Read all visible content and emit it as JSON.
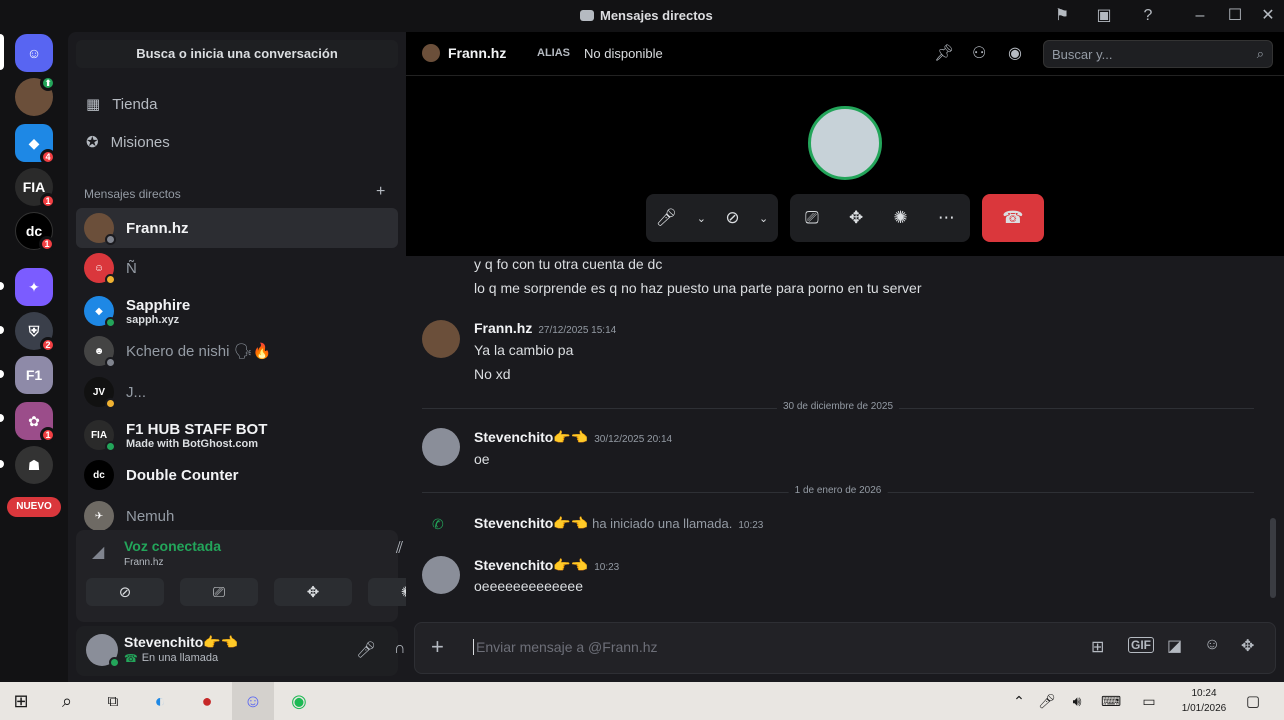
{
  "window": {
    "title": "Mensajes directos"
  },
  "rail": {
    "new_label": "NUEVO",
    "badges": [
      "4",
      "1",
      "1",
      "2",
      "1"
    ]
  },
  "sidebar": {
    "search_placeholder": "Busca o inicia una conversación",
    "nav": [
      {
        "label": "Tienda",
        "icon": "store-icon"
      },
      {
        "label": "Misiones",
        "icon": "quests-icon"
      }
    ],
    "dm_header": "Mensajes directos",
    "dms": [
      {
        "name": "Frann.hz",
        "sub": ""
      },
      {
        "name": "Ñ",
        "sub": ""
      },
      {
        "name": "Sapphire",
        "sub": "sapph.xyz"
      },
      {
        "name": "Kchero de nishi 🗣🔥",
        "sub": ""
      },
      {
        "name": "J...",
        "sub": ""
      },
      {
        "name": "F1 HUB STAFF BOT",
        "sub": "Made with BotGhost.com"
      },
      {
        "name": "Double Counter",
        "sub": ""
      },
      {
        "name": "Nemuh",
        "sub": ""
      }
    ]
  },
  "voice": {
    "status": "Voz conectada",
    "channel": "Frann.hz"
  },
  "user": {
    "name": "Stevenchito👉👈",
    "status": "En una llamada"
  },
  "header": {
    "name": "Frann.hz",
    "alias_label": "ALIAS",
    "alias_value": "No disponible",
    "search_placeholder": "Buscar y..."
  },
  "messages": {
    "line1": "y q fo con tu otra cuenta de dc",
    "line2": "lo q me sorprende es q no haz puesto una parte para porno en tu server",
    "m1_author": "Frann.hz",
    "m1_ts": "27/12/2025 15:14",
    "m1_l1": "Ya la cambio pa",
    "m1_l2": "No xd",
    "div1": "30 de diciembre de 2025",
    "m2_author": "Stevenchito👉👈",
    "m2_ts": "30/12/2025 20:14",
    "m2_l1": "oe",
    "div2": "1 de enero de 2026",
    "call_author": "Stevenchito👉👈",
    "call_text": "ha iniciado una llamada.",
    "call_ts": "10:23",
    "m3_author": "Stevenchito👉👈",
    "m3_ts": "10:23",
    "m3_l1": "oeeeeeeeeeeeee"
  },
  "composer": {
    "placeholder": "Enviar mensaje a @Frann.hz"
  },
  "taskbar": {
    "time": "10:24",
    "date": "1/01/2026"
  },
  "colors": {
    "accent": "#5865f2",
    "danger": "#da373c",
    "online": "#23a55a"
  }
}
